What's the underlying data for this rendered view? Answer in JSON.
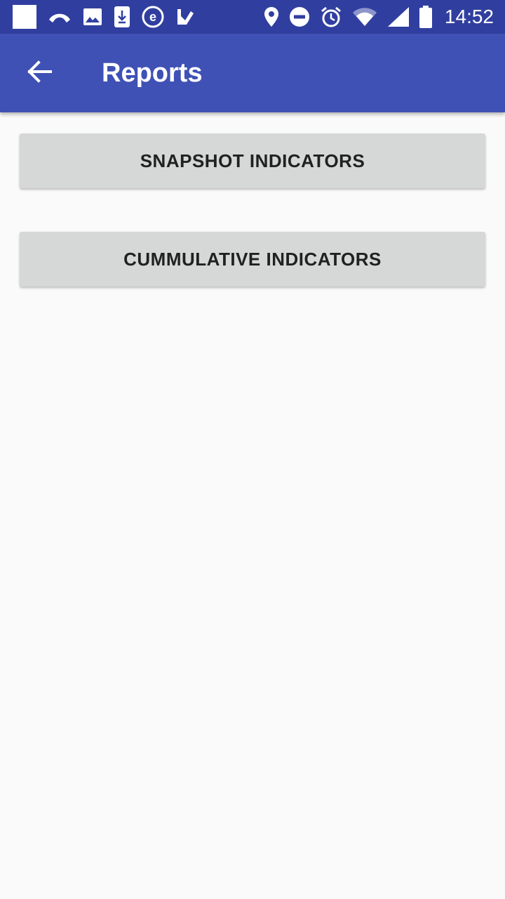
{
  "status_bar": {
    "time": "14:52",
    "left_icons": [
      "square-notification-icon",
      "missed-call-icon",
      "image-icon",
      "download-icon",
      "e-app-icon",
      "check-app-icon"
    ],
    "right_icons": [
      "location-icon",
      "do-not-disturb-icon",
      "alarm-icon",
      "wifi-icon",
      "signal-icon",
      "battery-icon"
    ],
    "background_color": "#303f9f"
  },
  "app_bar": {
    "title": "Reports",
    "back_icon": "back-arrow-icon",
    "background_color": "#3f51b5"
  },
  "buttons": [
    {
      "label": "SNAPSHOT INDICATORS"
    },
    {
      "label": "CUMMULATIVE INDICATORS"
    }
  ],
  "colors": {
    "page_background": "#fafafa",
    "button_background": "#d6d7d7",
    "button_text": "#212121"
  }
}
